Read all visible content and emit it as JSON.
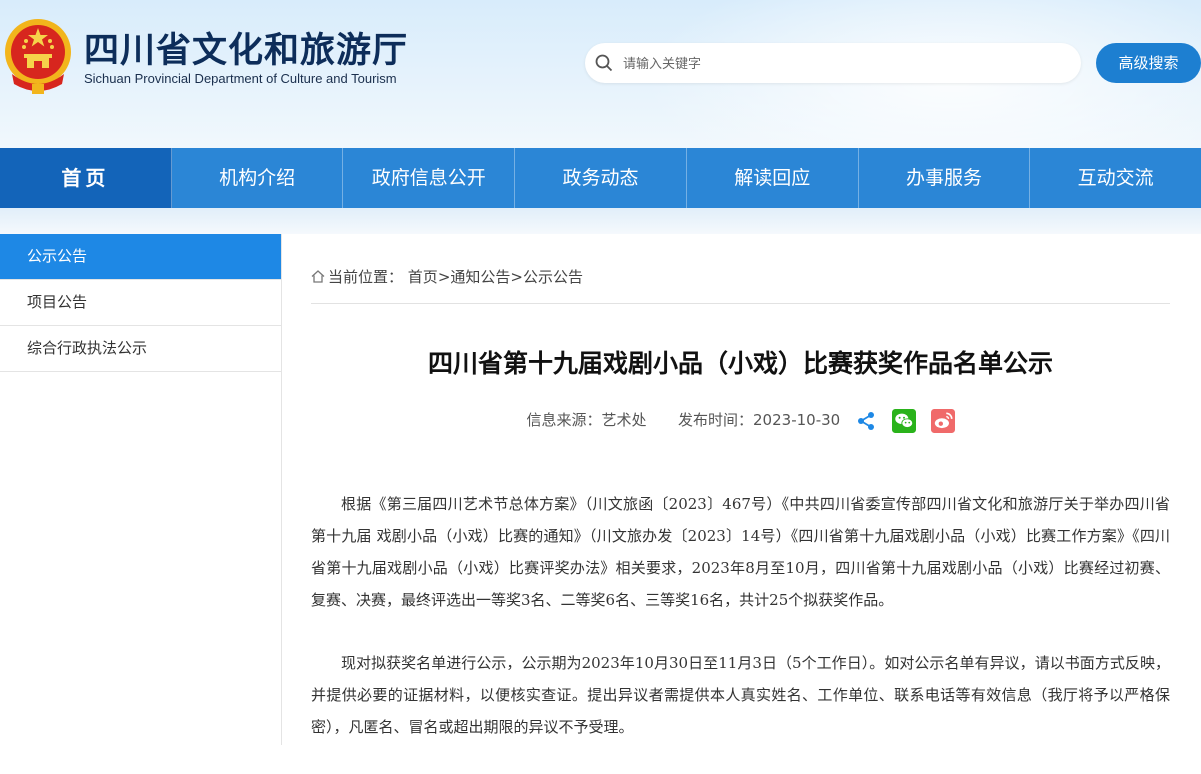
{
  "header": {
    "title": "四川省文化和旅游厅",
    "subtitle": "Sichuan Provincial Department of Culture and Tourism",
    "search_placeholder": "请输入关键字",
    "advanced_search": "高级搜索",
    "emblem_icon": "national-emblem-icon"
  },
  "nav": [
    {
      "label": "首页",
      "active": true
    },
    {
      "label": "机构介绍"
    },
    {
      "label": "政府信息公开"
    },
    {
      "label": "政务动态"
    },
    {
      "label": "解读回应"
    },
    {
      "label": "办事服务"
    },
    {
      "label": "互动交流"
    }
  ],
  "sidebar": [
    {
      "label": "公示公告",
      "active": true
    },
    {
      "label": "项目公告"
    },
    {
      "label": "综合行政执法公示"
    }
  ],
  "breadcrumb": {
    "prefix": "当前位置：",
    "items": [
      "首页",
      "通知公告",
      "公示公告"
    ],
    "separator": ">"
  },
  "article": {
    "title": "四川省第十九届戏剧小品（小戏）比赛获奖作品名单公示",
    "source": "信息来源：艺术处",
    "publish_time": "发布时间：2023-10-30",
    "share_icons": [
      "share-icon",
      "wechat-icon",
      "weibo-icon"
    ],
    "paragraphs": [
      "根据《第三届四川艺术节总体方案》（川文旅函〔2023〕467号）《中共四川省委宣传部四川省文化和旅游厅关于举办四川省第十九届 戏剧小品（小戏）比赛的通知》（川文旅办发〔2023〕14号）《四川省第十九届戏剧小品（小戏）比赛工作方案》《四川省第十九届戏剧小品（小戏）比赛评奖办法》相关要求，2023年8月至10月，四川省第十九届戏剧小品（小戏）比赛经过初赛、复赛、决赛，最终评选出一等奖3名、二等奖6名、三等奖16名，共计25个拟获奖作品。",
      "现对拟获奖名单进行公示，公示期为2023年10月30日至11月3日（5个工作日）。如对公示名单有异议，请以书面方式反映，并提供必要的证据材料，以便核实查证。提出异议者需提供本人真实姓名、工作单位、联系电话等有效信息（我厅将予以严格保密），凡匿名、冒名或超出期限的异议不予受理。"
    ]
  },
  "colors": {
    "nav_bg": "#2b86d6",
    "nav_active": "#1364b9",
    "accent": "#1d7fd1",
    "sidebar_active": "#1e88e5"
  }
}
